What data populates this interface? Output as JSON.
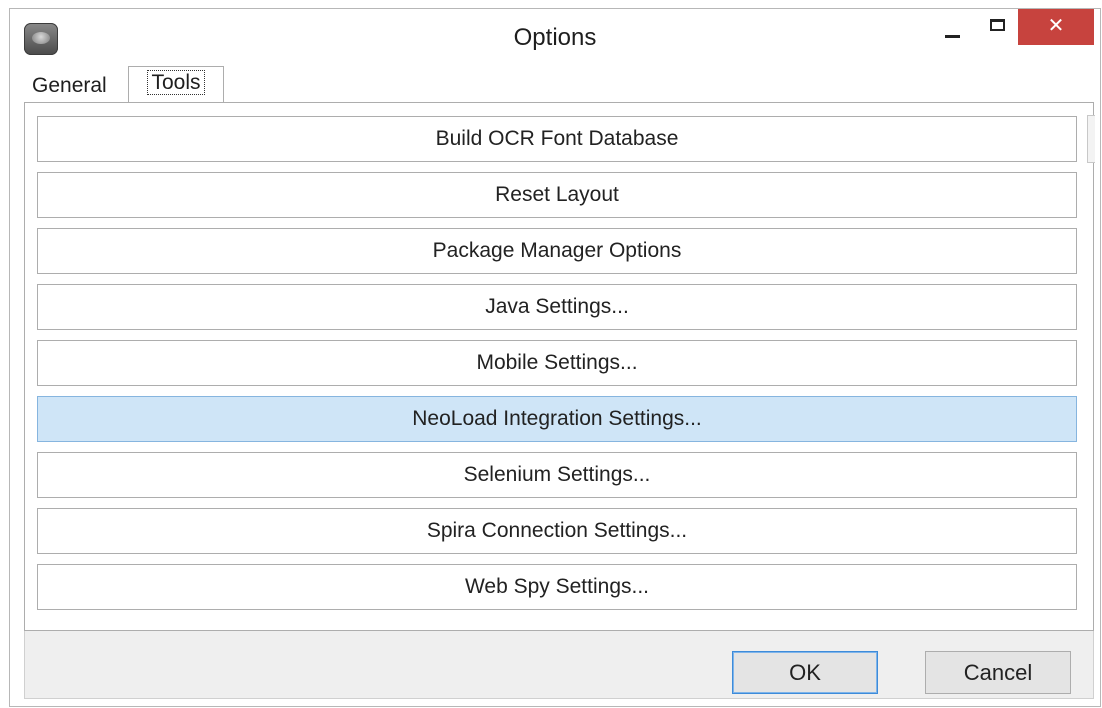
{
  "window": {
    "title": "Options"
  },
  "title_bar": {
    "icons": {
      "app": "app-icon",
      "minimize": "minimize-icon",
      "maximize": "maximize-icon",
      "close": "close-icon"
    },
    "close_glyph": "✕"
  },
  "tabs": [
    {
      "label": "General",
      "selected": false
    },
    {
      "label": "Tools",
      "selected": true
    }
  ],
  "tool_buttons": [
    {
      "label": "Build OCR Font Database",
      "highlighted": false
    },
    {
      "label": "Reset Layout",
      "highlighted": false
    },
    {
      "label": "Package Manager Options",
      "highlighted": false
    },
    {
      "label": "Java Settings...",
      "highlighted": false
    },
    {
      "label": "Mobile Settings...",
      "highlighted": false
    },
    {
      "label": "NeoLoad Integration Settings...",
      "highlighted": true
    },
    {
      "label": "Selenium Settings...",
      "highlighted": false
    },
    {
      "label": "Spira Connection Settings...",
      "highlighted": false
    },
    {
      "label": "Web Spy Settings...",
      "highlighted": false
    }
  ],
  "footer": {
    "ok_label": "OK",
    "cancel_label": "Cancel"
  },
  "colors": {
    "close_button": "#c7433e",
    "hover_button": "#cfe5f7",
    "default_button_focus": "#3d8bd9"
  }
}
